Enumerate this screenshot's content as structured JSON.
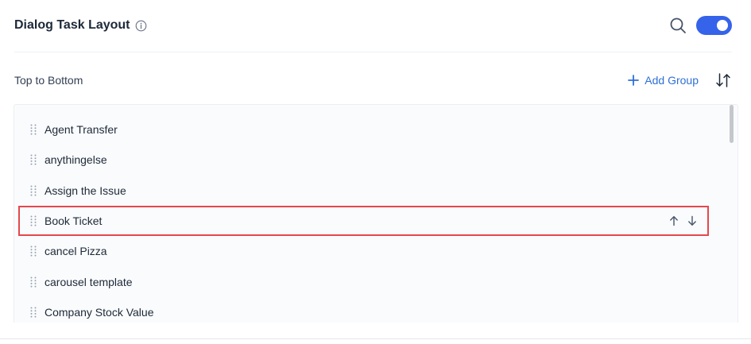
{
  "header": {
    "title": "Dialog Task Layout",
    "info_icon": "info-circle-icon",
    "search_icon": "search-icon",
    "toggle_state": "on"
  },
  "section": {
    "label": "Top to Bottom",
    "add_group_label": "Add Group",
    "add_icon": "plus-icon",
    "sort_icon": "sort-arrows-icon"
  },
  "list": {
    "items": [
      {
        "label": "Agent Transfer"
      },
      {
        "label": "anythingelse"
      },
      {
        "label": "Assign the Issue"
      },
      {
        "label": "Book Ticket",
        "selected": true
      },
      {
        "label": "cancel Pizza"
      },
      {
        "label": "carousel template"
      },
      {
        "label": "Company Stock Value"
      }
    ],
    "row_actions": {
      "move_up_icon": "arrow-up-icon",
      "move_down_icon": "arrow-down-icon"
    }
  },
  "colors": {
    "accent": "#3563e9",
    "link": "#2f6fd6",
    "selection_outline": "#e5484d"
  }
}
